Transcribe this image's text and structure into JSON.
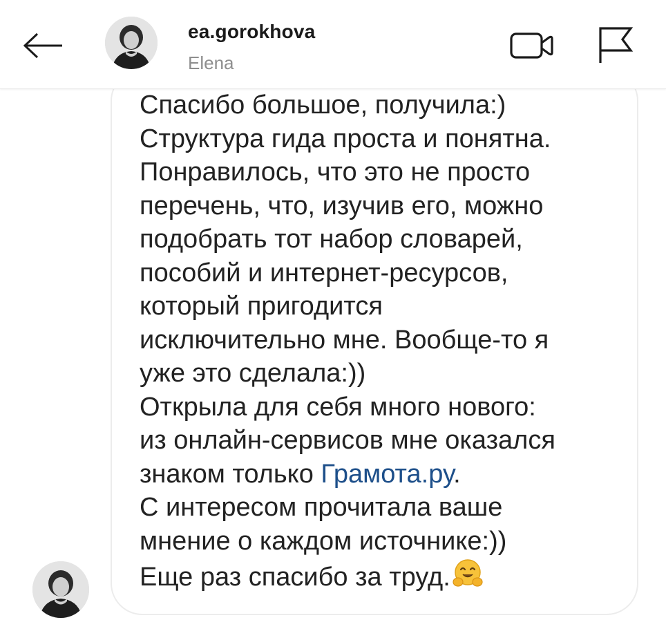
{
  "header": {
    "username": "ea.gorokhova",
    "fullname": "Elena",
    "back_icon": "arrow-left-icon",
    "video_icon": "video-call-icon",
    "flag_icon": "flag-icon",
    "avatar": "avatar-photo"
  },
  "message": {
    "lines": [
      "Спасибо большое, получила:)",
      "Структура гида проста и понятна.",
      "Понравилось, что это не просто",
      "перечень, что, изучив его, можно",
      "подобрать тот набор словарей,",
      "пособий и интернет-ресурсов,",
      "который пригодится",
      "исключительно мне. Вообще-то я",
      "уже это сделала:))",
      "Открыла для себя много нового:",
      "из онлайн-сервисов мне оказался"
    ],
    "link_line_prefix": "знаком только ",
    "link_text": "Грамота.ру",
    "link_line_suffix": ".",
    "after_link_lines": [
      "С интересом прочитала ваше",
      "мнение о каждом источнике:))"
    ],
    "last_line": "Еще раз спасибо за труд.",
    "emoji": "hugging-face-emoji"
  },
  "colors": {
    "text": "#222222",
    "link": "#1d4f8a",
    "muted": "#8e8e8e",
    "bubble_border": "#ececec"
  }
}
